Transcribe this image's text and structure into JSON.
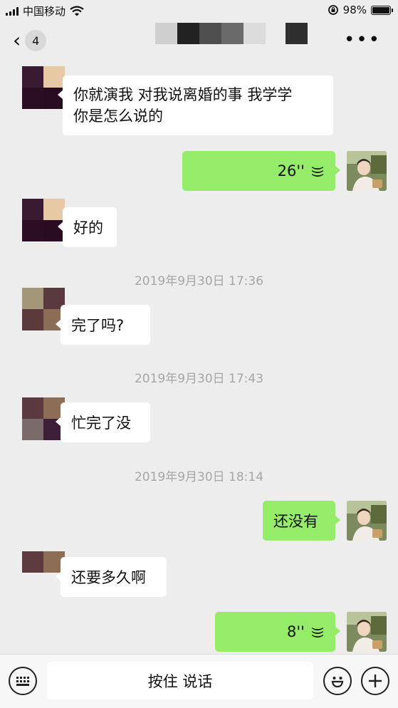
{
  "status_bar": {
    "carrier": "中国移动",
    "battery": "98%",
    "battery_level": 0.98
  },
  "nav": {
    "unread_count": "4",
    "title_blurred": true,
    "more_label": "•••"
  },
  "messages": [
    {
      "side": "left",
      "text_line1": "你就演我  对我说离婚的事  我学学",
      "text_line2": "你是怎么说的"
    },
    {
      "side": "right",
      "type": "voice",
      "duration": "26''"
    },
    {
      "side": "left",
      "text": "好的"
    },
    {
      "timestamp": "2019年9月30日 17:36"
    },
    {
      "side": "left",
      "text": "完了吗?"
    },
    {
      "timestamp": "2019年9月30日 17:43"
    },
    {
      "side": "left",
      "text": "忙完了没"
    },
    {
      "timestamp": "2019年9月30日 18:14"
    },
    {
      "side": "right",
      "text": "还没有"
    },
    {
      "side": "left",
      "text": "还要多久啊"
    },
    {
      "side": "right",
      "type": "voice",
      "duration": "8''"
    }
  ],
  "input_bar": {
    "hold_to_talk": "按住 说话"
  },
  "colors": {
    "background": "#ededed",
    "self_bubble": "#95ec69",
    "other_bubble": "#ffffff",
    "timestamp": "#a6a6a6"
  },
  "icons": [
    "signal-icon",
    "wifi-icon",
    "rotation-lock-icon",
    "battery-icon",
    "back-chevron-icon",
    "more-icon",
    "voice-wave-icon",
    "keyboard-icon",
    "emoji-icon",
    "plus-icon"
  ]
}
